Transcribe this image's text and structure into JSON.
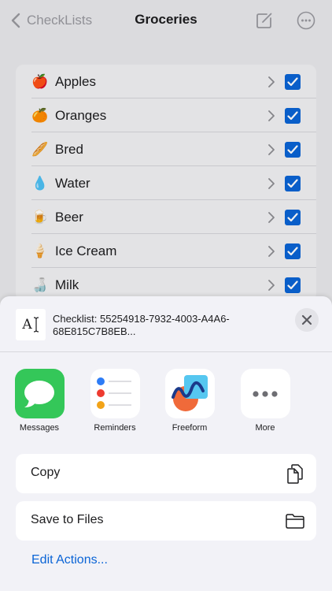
{
  "nav": {
    "back_label": "CheckLists",
    "title": "Groceries"
  },
  "checklist": {
    "items": [
      {
        "emoji": "🍎",
        "label": "Apples",
        "checked": true
      },
      {
        "emoji": "🍊",
        "label": "Oranges",
        "checked": true
      },
      {
        "emoji": "🥖",
        "label": "Bred",
        "checked": true
      },
      {
        "emoji": "💧",
        "label": "Water",
        "checked": true
      },
      {
        "emoji": "🍺",
        "label": "Beer",
        "checked": true
      },
      {
        "emoji": "🍦",
        "label": "Ice Cream",
        "checked": true
      },
      {
        "emoji": "🍶",
        "label": "Milk",
        "checked": true
      }
    ]
  },
  "share_sheet": {
    "doc_glyph": "A",
    "doc_title": "Checklist: 55254918-7932-4003-A4A6-68E815C7B8EB...",
    "apps": [
      {
        "name": "Messages",
        "icon": "messages-icon"
      },
      {
        "name": "Reminders",
        "icon": "reminders-icon"
      },
      {
        "name": "Freeform",
        "icon": "freeform-icon"
      },
      {
        "name": "More",
        "icon": "more-icon"
      }
    ],
    "actions": [
      {
        "label": "Copy",
        "icon": "copy-icon"
      },
      {
        "label": "Save to Files",
        "icon": "folder-icon"
      }
    ],
    "edit_actions": "Edit Actions..."
  },
  "colors": {
    "accent": "#0a64d6",
    "messages_green": "#34c759"
  }
}
